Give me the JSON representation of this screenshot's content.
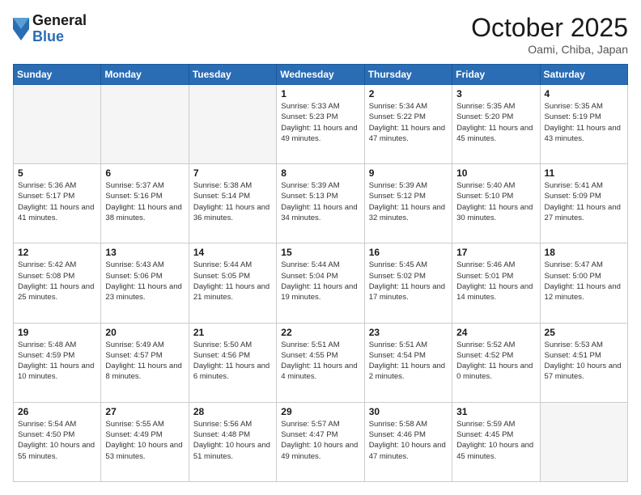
{
  "header": {
    "logo_line1": "General",
    "logo_line2": "Blue",
    "month_title": "October 2025",
    "location": "Oami, Chiba, Japan"
  },
  "weekdays": [
    "Sunday",
    "Monday",
    "Tuesday",
    "Wednesday",
    "Thursday",
    "Friday",
    "Saturday"
  ],
  "weeks": [
    [
      {
        "day": "",
        "sunrise": "",
        "sunset": "",
        "daylight": ""
      },
      {
        "day": "",
        "sunrise": "",
        "sunset": "",
        "daylight": ""
      },
      {
        "day": "",
        "sunrise": "",
        "sunset": "",
        "daylight": ""
      },
      {
        "day": "1",
        "sunrise": "Sunrise: 5:33 AM",
        "sunset": "Sunset: 5:23 PM",
        "daylight": "Daylight: 11 hours and 49 minutes."
      },
      {
        "day": "2",
        "sunrise": "Sunrise: 5:34 AM",
        "sunset": "Sunset: 5:22 PM",
        "daylight": "Daylight: 11 hours and 47 minutes."
      },
      {
        "day": "3",
        "sunrise": "Sunrise: 5:35 AM",
        "sunset": "Sunset: 5:20 PM",
        "daylight": "Daylight: 11 hours and 45 minutes."
      },
      {
        "day": "4",
        "sunrise": "Sunrise: 5:35 AM",
        "sunset": "Sunset: 5:19 PM",
        "daylight": "Daylight: 11 hours and 43 minutes."
      }
    ],
    [
      {
        "day": "5",
        "sunrise": "Sunrise: 5:36 AM",
        "sunset": "Sunset: 5:17 PM",
        "daylight": "Daylight: 11 hours and 41 minutes."
      },
      {
        "day": "6",
        "sunrise": "Sunrise: 5:37 AM",
        "sunset": "Sunset: 5:16 PM",
        "daylight": "Daylight: 11 hours and 38 minutes."
      },
      {
        "day": "7",
        "sunrise": "Sunrise: 5:38 AM",
        "sunset": "Sunset: 5:14 PM",
        "daylight": "Daylight: 11 hours and 36 minutes."
      },
      {
        "day": "8",
        "sunrise": "Sunrise: 5:39 AM",
        "sunset": "Sunset: 5:13 PM",
        "daylight": "Daylight: 11 hours and 34 minutes."
      },
      {
        "day": "9",
        "sunrise": "Sunrise: 5:39 AM",
        "sunset": "Sunset: 5:12 PM",
        "daylight": "Daylight: 11 hours and 32 minutes."
      },
      {
        "day": "10",
        "sunrise": "Sunrise: 5:40 AM",
        "sunset": "Sunset: 5:10 PM",
        "daylight": "Daylight: 11 hours and 30 minutes."
      },
      {
        "day": "11",
        "sunrise": "Sunrise: 5:41 AM",
        "sunset": "Sunset: 5:09 PM",
        "daylight": "Daylight: 11 hours and 27 minutes."
      }
    ],
    [
      {
        "day": "12",
        "sunrise": "Sunrise: 5:42 AM",
        "sunset": "Sunset: 5:08 PM",
        "daylight": "Daylight: 11 hours and 25 minutes."
      },
      {
        "day": "13",
        "sunrise": "Sunrise: 5:43 AM",
        "sunset": "Sunset: 5:06 PM",
        "daylight": "Daylight: 11 hours and 23 minutes."
      },
      {
        "day": "14",
        "sunrise": "Sunrise: 5:44 AM",
        "sunset": "Sunset: 5:05 PM",
        "daylight": "Daylight: 11 hours and 21 minutes."
      },
      {
        "day": "15",
        "sunrise": "Sunrise: 5:44 AM",
        "sunset": "Sunset: 5:04 PM",
        "daylight": "Daylight: 11 hours and 19 minutes."
      },
      {
        "day": "16",
        "sunrise": "Sunrise: 5:45 AM",
        "sunset": "Sunset: 5:02 PM",
        "daylight": "Daylight: 11 hours and 17 minutes."
      },
      {
        "day": "17",
        "sunrise": "Sunrise: 5:46 AM",
        "sunset": "Sunset: 5:01 PM",
        "daylight": "Daylight: 11 hours and 14 minutes."
      },
      {
        "day": "18",
        "sunrise": "Sunrise: 5:47 AM",
        "sunset": "Sunset: 5:00 PM",
        "daylight": "Daylight: 11 hours and 12 minutes."
      }
    ],
    [
      {
        "day": "19",
        "sunrise": "Sunrise: 5:48 AM",
        "sunset": "Sunset: 4:59 PM",
        "daylight": "Daylight: 11 hours and 10 minutes."
      },
      {
        "day": "20",
        "sunrise": "Sunrise: 5:49 AM",
        "sunset": "Sunset: 4:57 PM",
        "daylight": "Daylight: 11 hours and 8 minutes."
      },
      {
        "day": "21",
        "sunrise": "Sunrise: 5:50 AM",
        "sunset": "Sunset: 4:56 PM",
        "daylight": "Daylight: 11 hours and 6 minutes."
      },
      {
        "day": "22",
        "sunrise": "Sunrise: 5:51 AM",
        "sunset": "Sunset: 4:55 PM",
        "daylight": "Daylight: 11 hours and 4 minutes."
      },
      {
        "day": "23",
        "sunrise": "Sunrise: 5:51 AM",
        "sunset": "Sunset: 4:54 PM",
        "daylight": "Daylight: 11 hours and 2 minutes."
      },
      {
        "day": "24",
        "sunrise": "Sunrise: 5:52 AM",
        "sunset": "Sunset: 4:52 PM",
        "daylight": "Daylight: 11 hours and 0 minutes."
      },
      {
        "day": "25",
        "sunrise": "Sunrise: 5:53 AM",
        "sunset": "Sunset: 4:51 PM",
        "daylight": "Daylight: 10 hours and 57 minutes."
      }
    ],
    [
      {
        "day": "26",
        "sunrise": "Sunrise: 5:54 AM",
        "sunset": "Sunset: 4:50 PM",
        "daylight": "Daylight: 10 hours and 55 minutes."
      },
      {
        "day": "27",
        "sunrise": "Sunrise: 5:55 AM",
        "sunset": "Sunset: 4:49 PM",
        "daylight": "Daylight: 10 hours and 53 minutes."
      },
      {
        "day": "28",
        "sunrise": "Sunrise: 5:56 AM",
        "sunset": "Sunset: 4:48 PM",
        "daylight": "Daylight: 10 hours and 51 minutes."
      },
      {
        "day": "29",
        "sunrise": "Sunrise: 5:57 AM",
        "sunset": "Sunset: 4:47 PM",
        "daylight": "Daylight: 10 hours and 49 minutes."
      },
      {
        "day": "30",
        "sunrise": "Sunrise: 5:58 AM",
        "sunset": "Sunset: 4:46 PM",
        "daylight": "Daylight: 10 hours and 47 minutes."
      },
      {
        "day": "31",
        "sunrise": "Sunrise: 5:59 AM",
        "sunset": "Sunset: 4:45 PM",
        "daylight": "Daylight: 10 hours and 45 minutes."
      },
      {
        "day": "",
        "sunrise": "",
        "sunset": "",
        "daylight": ""
      }
    ]
  ]
}
